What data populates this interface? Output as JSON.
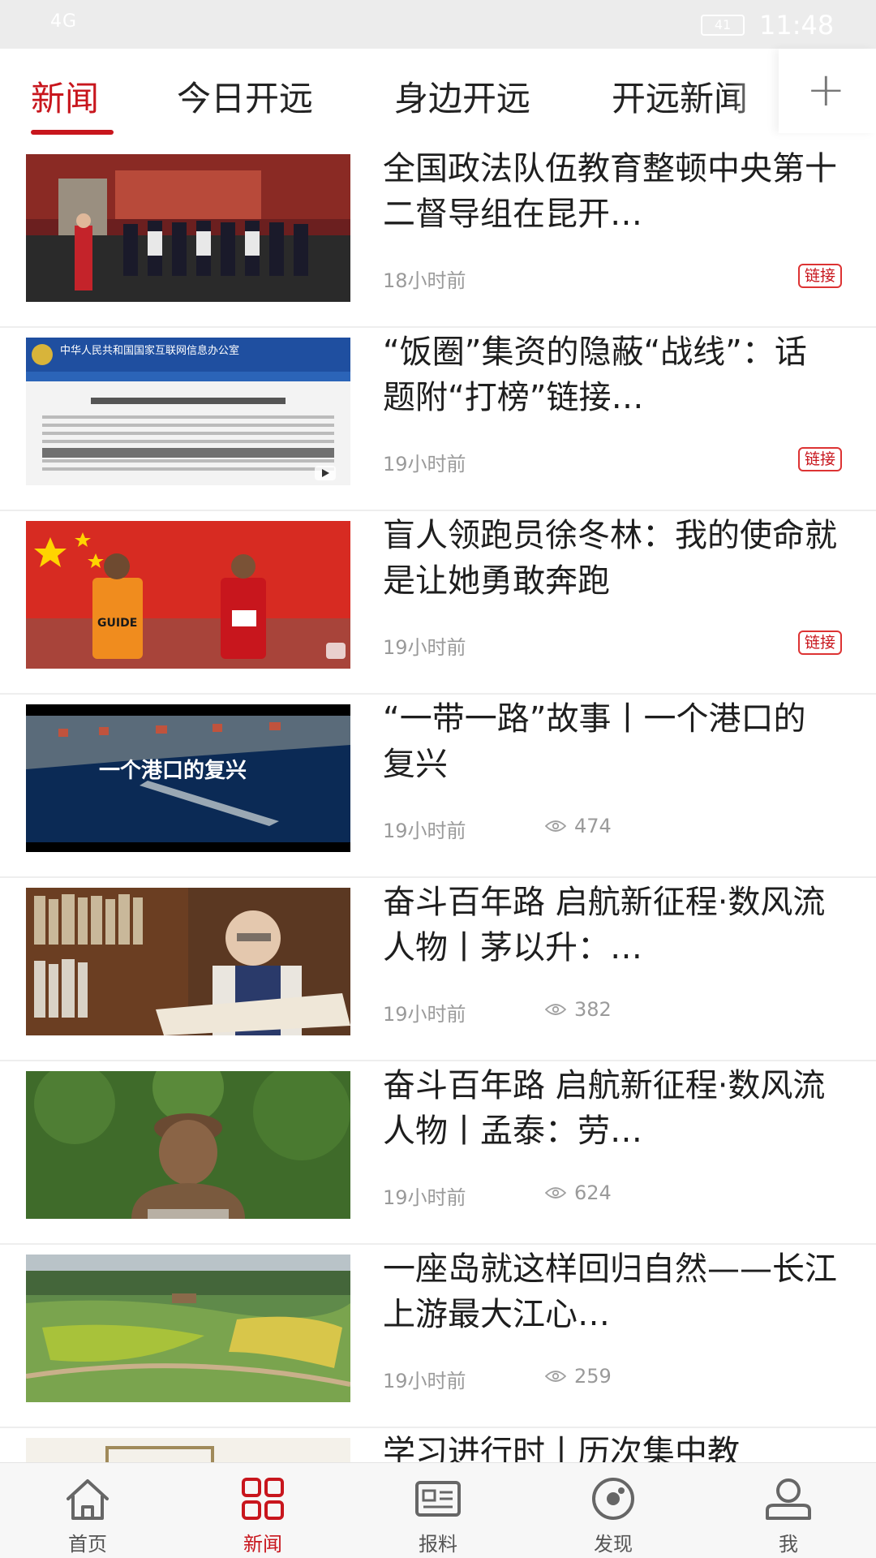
{
  "status_bar": {
    "signal": "4G",
    "battery": "41",
    "time": "11:48"
  },
  "tabs": [
    {
      "label": "新闻",
      "active": true
    },
    {
      "label": "今日开远",
      "active": false
    },
    {
      "label": "身边开远",
      "active": false
    },
    {
      "label": "开远新闻",
      "active": false
    }
  ],
  "add_tab_icon": "plus-icon",
  "accent_color": "#c8161d",
  "news": [
    {
      "title": "全国政法队伍教育整顿中央第十二督导组在昆开…",
      "time": "18小时前",
      "badge": "链接",
      "thumb": "officials-exhibition-photo"
    },
    {
      "title": "“饭圈”集资的隐蔽“战线”：话题附“打榜”链接…",
      "time": "19小时前",
      "badge": "链接",
      "thumb": "cyberspace-website-screenshot",
      "thumb_text": "中华人民共和国国家互联网信息办公室"
    },
    {
      "title": "盲人领跑员徐冬林：我的使命就是让她勇敢奔跑",
      "time": "19小时前",
      "badge": "链接",
      "thumb": "athletes-with-flag-photo",
      "thumb_text": "GUIDE"
    },
    {
      "title": "“一带一路”故事丨一个港口的复兴",
      "time": "19小时前",
      "views": "474",
      "thumb": "port-aerial-photo",
      "thumb_text": "一个港口的复兴"
    },
    {
      "title": "奋斗百年路 启航新征程·数风流人物丨茅以升：…",
      "time": "19小时前",
      "views": "382",
      "thumb": "elderly-man-reading-photo"
    },
    {
      "title": "奋斗百年路 启航新征程·数风流人物丨孟泰：劳…",
      "time": "19小时前",
      "views": "624",
      "thumb": "bronze-bust-photo"
    },
    {
      "title": "一座岛就这样回归自然——长江上游最大江心…",
      "time": "19小时前",
      "views": "259",
      "thumb": "island-aerial-photo"
    },
    {
      "title": "学习进行时丨历次集中教",
      "time": "",
      "thumb": "document-photo"
    }
  ],
  "bottom_nav": [
    {
      "label": "首页",
      "icon": "home-icon",
      "active": false
    },
    {
      "label": "新闻",
      "icon": "grid-icon",
      "active": true
    },
    {
      "label": "报料",
      "icon": "news-card-icon",
      "active": false
    },
    {
      "label": "发现",
      "icon": "discover-icon",
      "active": false
    },
    {
      "label": "我",
      "icon": "user-icon",
      "active": false
    }
  ]
}
